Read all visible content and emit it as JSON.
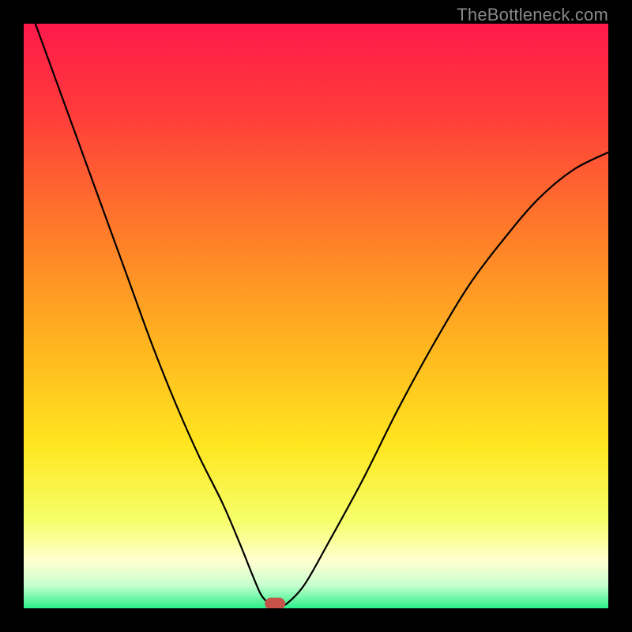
{
  "watermark": "TheBottleneck.com",
  "chart_data": {
    "type": "line",
    "title": "",
    "xlabel": "",
    "ylabel": "",
    "xlim": [
      0,
      100
    ],
    "ylim": [
      0,
      100
    ],
    "grid": false,
    "legend": false,
    "background_gradient_stops": [
      {
        "offset": 0.0,
        "color": "#ff1a4b"
      },
      {
        "offset": 0.15,
        "color": "#ff3b3b"
      },
      {
        "offset": 0.35,
        "color": "#ff7a2a"
      },
      {
        "offset": 0.55,
        "color": "#ffb51f"
      },
      {
        "offset": 0.72,
        "color": "#ffe61f"
      },
      {
        "offset": 0.85,
        "color": "#f6ff6a"
      },
      {
        "offset": 0.92,
        "color": "#ffffd0"
      },
      {
        "offset": 0.96,
        "color": "#c9ffd0"
      },
      {
        "offset": 1.0,
        "color": "#2bf08a"
      }
    ],
    "series": [
      {
        "name": "bottleneck-curve",
        "color": "#000000",
        "stroke_width": 2.2,
        "x": [
          2,
          6,
          10,
          14,
          18,
          22,
          26,
          30,
          34,
          37,
          39,
          40.5,
          41.5,
          42,
          44,
          45,
          48,
          52,
          58,
          64,
          70,
          76,
          82,
          88,
          94,
          100
        ],
        "y": [
          100,
          89,
          78,
          67,
          56,
          45,
          35,
          26,
          18,
          11,
          6,
          2.5,
          1.2,
          0.8,
          0.8,
          0.8,
          4,
          11,
          22,
          34,
          45,
          55,
          63,
          70,
          75,
          78
        ]
      }
    ],
    "marker": {
      "name": "optimum-marker",
      "x": 43,
      "y": 0.8,
      "width": 3.5,
      "height": 2.0,
      "rx": 1.0,
      "color": "#c5534a"
    }
  }
}
